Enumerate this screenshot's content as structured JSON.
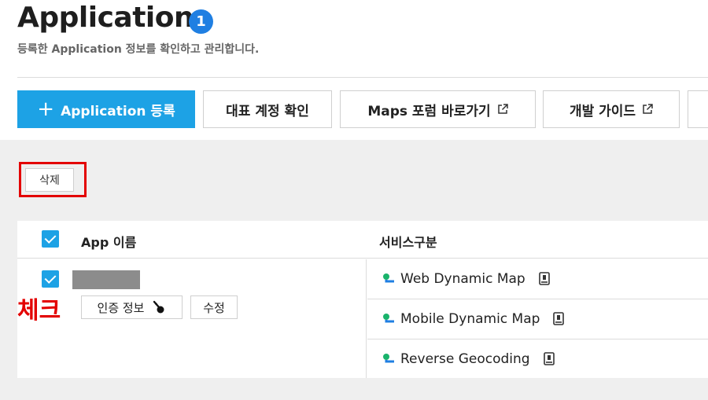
{
  "header": {
    "title": "Application",
    "badge": "1",
    "subtitle": "등록한 Application 정보를 확인하고 관리합니다."
  },
  "toolbar": {
    "register_label": "Application 등록",
    "main_account_label": "대표 계정 확인",
    "maps_forum_label": "Maps 포럼 바로가기",
    "dev_guide_label": "개발 가이드"
  },
  "actions": {
    "delete_label": "삭제"
  },
  "table": {
    "col_app_name": "App 이름",
    "col_service": "서비스구분",
    "row": {
      "annotation": "체크",
      "auth_info_label": "인증 정보",
      "edit_label": "수정",
      "services": [
        {
          "name": "Web Dynamic Map",
          "icon": "map-pin-icon"
        },
        {
          "name": "Mobile Dynamic Map",
          "icon": "map-pin-icon"
        },
        {
          "name": "Reverse Geocoding",
          "icon": "map-pin-icon"
        }
      ]
    }
  },
  "colors": {
    "primary": "#1da2e5",
    "badge": "#1f7fe2",
    "highlight_red": "#e30000",
    "background_gray": "#efefef"
  }
}
